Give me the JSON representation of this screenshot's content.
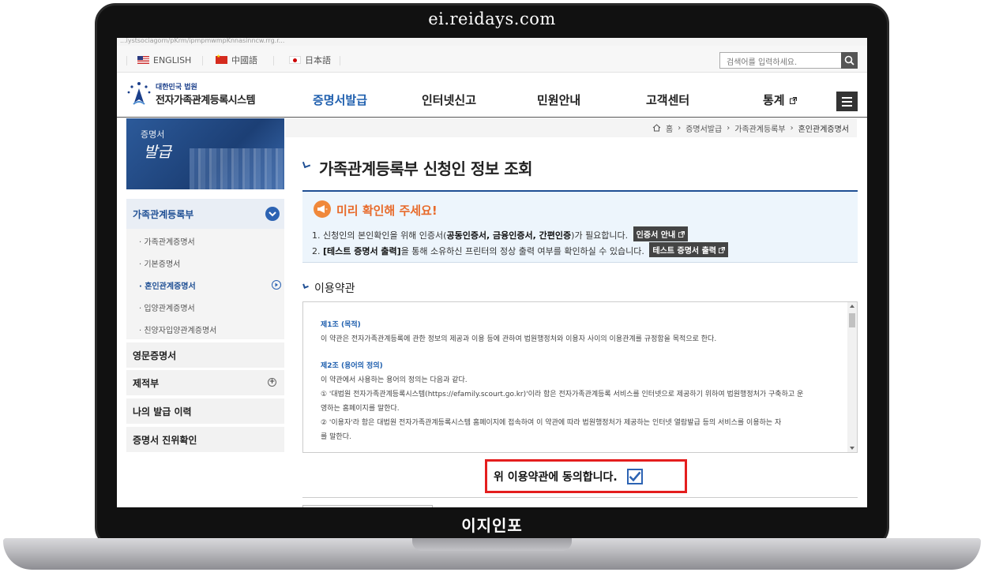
{
  "watermark": {
    "site": "ei.reidays.com",
    "brand": "이지인포"
  },
  "browser": {
    "url_fragment": "...iystsociagorn/pKrm/ipmpmwmpKnnasinncw.rrg.r..."
  },
  "topbar": {
    "languages": [
      {
        "label": "ENGLISH",
        "flag": "us-flag-icon"
      },
      {
        "label": "中國語",
        "flag": "cn-flag-icon"
      },
      {
        "label": "日本語",
        "flag": "jp-flag-icon"
      }
    ],
    "search_placeholder": "검색어를 입력하세요."
  },
  "header": {
    "logo_small": "대한민국 법원",
    "logo_big": "전자가족관계등록시스템",
    "nav": [
      "증명서발급",
      "인터넷신고",
      "민원안내",
      "고객센터",
      "통계"
    ],
    "active_nav": "증명서발급"
  },
  "sidebar": {
    "banner_small": "증명서",
    "banner_big": "발급",
    "section_title": "가족관계등록부",
    "sub_items": [
      "가족관계증명서",
      "기본증명서",
      "혼인관계증명서",
      "입양관계증명서",
      "친양자입양관계증명서"
    ],
    "active_sub": "혼인관계증명서",
    "menus": [
      "영문증명서",
      "제적부",
      "나의 발급 이력",
      "증명서 진위확인"
    ]
  },
  "breadcrumb": [
    "홈",
    "증명서발급",
    "가족관계등록부",
    "혼인관계증명서"
  ],
  "main": {
    "title": "가족관계등록부 신청인 정보 조회",
    "notice": {
      "title": "미리 확인해 주세요!",
      "line1_pre": "1. 신청인의 본인확인을 위해 인증서(",
      "line1_bold": "공동인증서, 금융인증서, 간편인증",
      "line1_post": ")가 필요합니다.",
      "line1_btn": "인증서 안내",
      "line2_pre": "2. ",
      "line2_bold": "[테스트 증명서 출력]",
      "line2_post": "을 통해 소유하신 프린터의 정상 출력 여부를 확인하실 수 있습니다.",
      "line2_btn": "테스트 증명서 출력"
    },
    "terms_title": "이용약관",
    "terms": {
      "art1_title": "제1조 (목적)",
      "art1_body": "이 약관은 전자가족관계등록에 관한 정보의 제공과 이용 등에 관하여 법원행정처와 이용자 사이의 이용관계를 규정함을 목적으로 한다.",
      "art2_title": "제2조 (용어의 정의)",
      "art2_intro": "이 약관에서 사용하는 용어의 정의는 다음과 같다.",
      "art2_item1a": "① '대법원 전자가족관계등록시스템(https://efamily.scourt.go.kr)'이라 함은 전자가족관계등록 서비스를 인터넷으로 제공하기 위하여 법원행정처가 구축하고 운",
      "art2_item1b": "영하는 홈페이지를 말한다.",
      "art2_item2a": "② '이용자'라 함은 대법원 전자가족관계등록시스템 홈페이지에 접속하여 이 약관에 따라 법원행정처가 제공하는 인터넷 열람발급 등의 서비스를 이용하는 자",
      "art2_item2b": "를 말한다."
    },
    "agree_label": "위 이용약관에 동의합니다.",
    "agree_checked": true
  }
}
